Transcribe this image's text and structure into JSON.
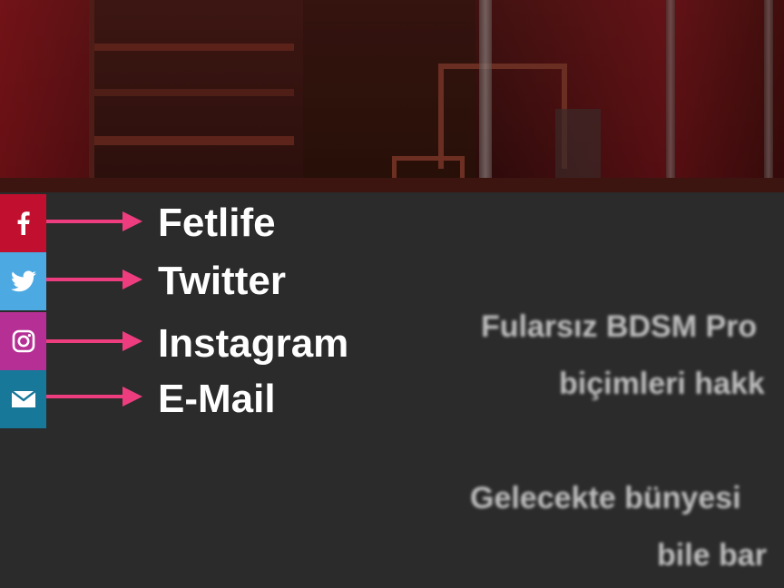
{
  "colors": {
    "facebook": "#c1102f",
    "twitter": "#4da9e2",
    "instagram": "#b52f94",
    "email": "#17789a",
    "arrow": "#ee3d7e",
    "background": "#2b2b2b"
  },
  "social": [
    {
      "icon": "facebook-icon",
      "label": "Fetlife"
    },
    {
      "icon": "twitter-icon",
      "label": "Twitter"
    },
    {
      "icon": "instagram-icon",
      "label": "Instagram"
    },
    {
      "icon": "email-icon",
      "label": "E-Mail"
    }
  ],
  "content": {
    "line1": "Fularsız BDSM Pro",
    "line2": "biçimleri hakk",
    "line3": "Gelecekte bünyesi",
    "line4": "bile bar"
  }
}
